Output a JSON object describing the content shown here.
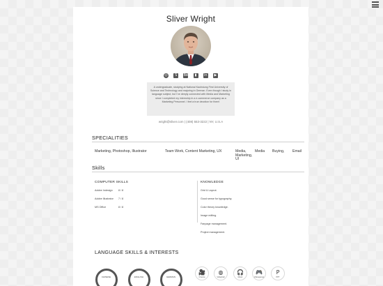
{
  "profile": {
    "name": "Sliver Wright",
    "bio": "A undergraduate, studying at National Kaohsiung First University of Science and Technology and majoring in German. Even though I study in language subject, but I've deeply connected with Media and Marketing since I completed my internship in a e-commerce company as a Marketing Personnel. I feel a true devotion for them!",
    "contact": "wright@sliver.com | (408) 553-3222 | NY, U.S.A"
  },
  "socials": [
    {
      "icon": "dribbble-icon",
      "glyph": "◎"
    },
    {
      "icon": "skype-icon",
      "glyph": "S"
    },
    {
      "icon": "behance-icon",
      "glyph": "Bē"
    },
    {
      "icon": "stats-icon",
      "glyph": "▮"
    },
    {
      "icon": "linkedin-icon",
      "glyph": "in"
    },
    {
      "icon": "youtube-icon",
      "glyph": "▶"
    }
  ],
  "specialities": {
    "title": "SPECIALITIES",
    "items": [
      "Marketing, Photoshop, Illustrator",
      "Team Work, Content Marketing, UX",
      "Media, Marketing, UI",
      "Media",
      "Buying,",
      "Email"
    ]
  },
  "skills": {
    "title": "Skills",
    "computer_title": "COMPUTER SKILLS",
    "computer": [
      {
        "name": "Adobe Indesign",
        "level": "8 / 8"
      },
      {
        "name": "Adobe Illustrator",
        "level": "7 / 8"
      },
      {
        "name": "MS Office",
        "level": "8 / 8"
      }
    ],
    "knowledge_title": "KNOWLEDGE",
    "knowledge": [
      "Grid & Layout.",
      "Good sense for typography.",
      "Color theory knowledge.",
      "Image editing.",
      "Fanpage management.",
      "Project management."
    ]
  },
  "languages": {
    "title": "LANGUAGE SKILLS & INTERESTS",
    "items": [
      "CHINESE",
      "ENGLISH",
      "GERMAN"
    ]
  },
  "interests": [
    {
      "icon": "film-camera-icon",
      "glyph": "🎥",
      "label": "Cinema"
    },
    {
      "icon": "volleyball-icon",
      "glyph": "◍",
      "label": "Volleyball"
    },
    {
      "icon": "headphones-icon",
      "glyph": "🎧",
      "label": "Music"
    },
    {
      "icon": "gamepad-icon",
      "glyph": "🎮",
      "label": "Videogames"
    },
    {
      "icon": "powerpoint-icon",
      "glyph": "P",
      "label": "PPT"
    }
  ],
  "colors": {
    "accent": "#555555",
    "card": "#ffffff",
    "bio_bg": "#ececec"
  }
}
